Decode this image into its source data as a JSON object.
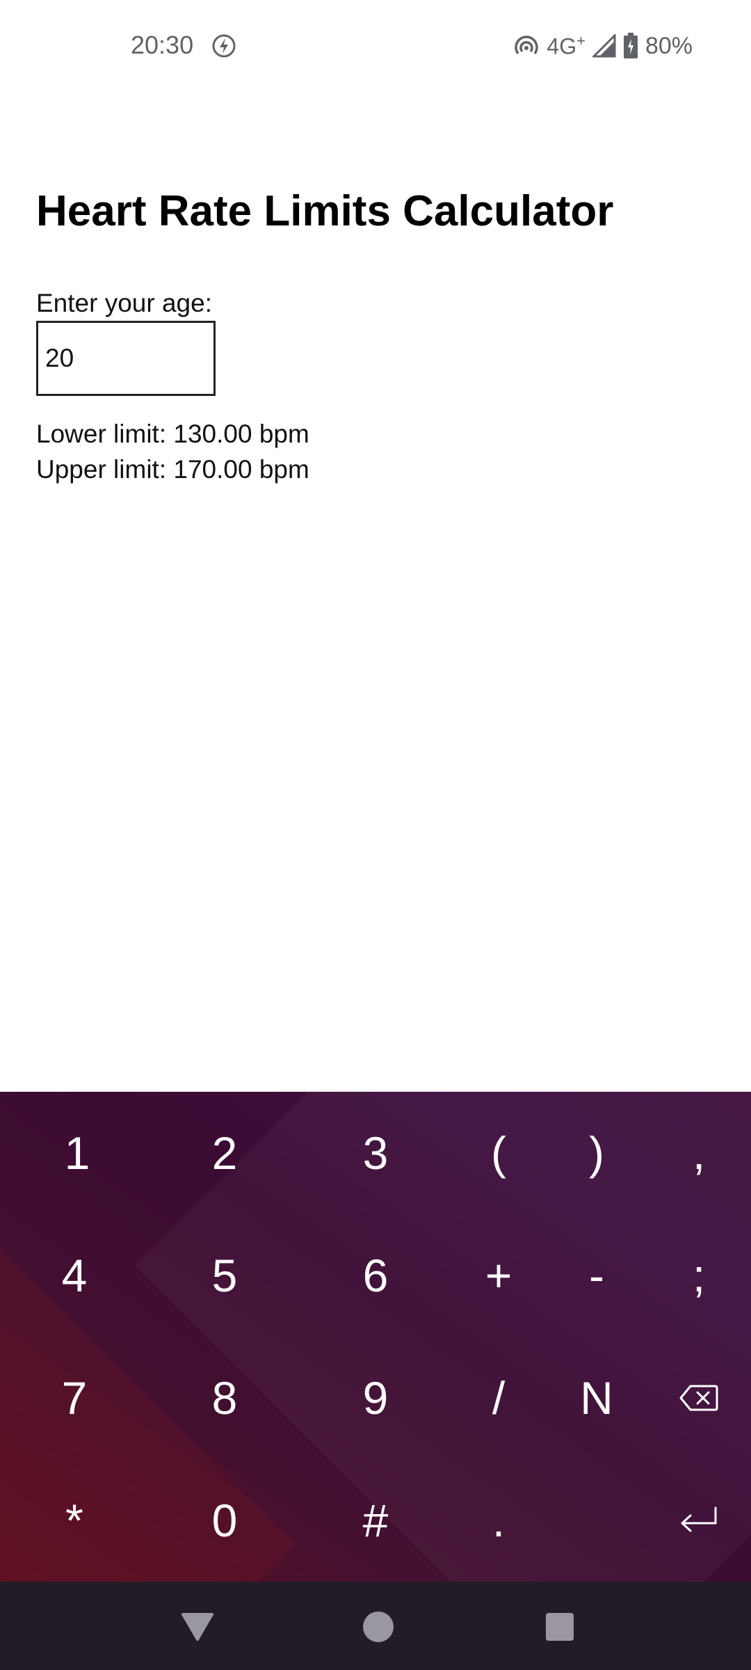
{
  "status_bar": {
    "time": "20:30",
    "network": "4G",
    "network_plus": "+",
    "battery": "80%",
    "icons": [
      "charging-icon",
      "hotspot-icon",
      "signal-icon",
      "battery-icon"
    ]
  },
  "app": {
    "title": "Heart Rate Limits Calculator",
    "age_label": "Enter your age:",
    "age_value": "20",
    "lower_limit": "Lower limit: 130.00 bpm",
    "upper_limit": "Upper limit: 170.00 bpm"
  },
  "keyboard": {
    "row1": [
      "1",
      "2",
      "3",
      "(",
      ")",
      ","
    ],
    "row2": [
      "4",
      "5",
      "6",
      "+",
      "-",
      ";"
    ],
    "row3": [
      "7",
      "8",
      "9",
      "/",
      "N"
    ],
    "row4": [
      "*",
      "0",
      "#",
      "."
    ],
    "icons": [
      "backspace-icon",
      "enter-icon"
    ]
  },
  "nav_bar": {
    "icons": [
      "back-icon",
      "home-icon",
      "recents-icon"
    ]
  },
  "colors": {
    "keyboard_bg": "#3b0b33",
    "nav_bg": "#221c28",
    "status_text": "#5f6368"
  }
}
